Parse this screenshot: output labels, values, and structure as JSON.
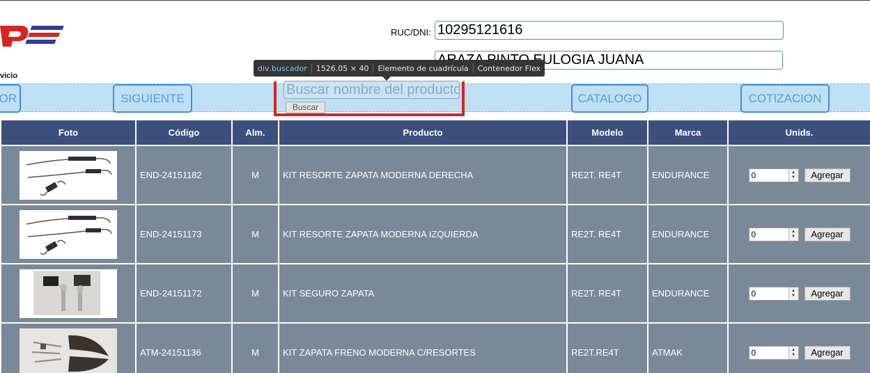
{
  "header": {
    "logo_text": "vicio",
    "ruc_label": "RUC/DNI:",
    "ruc_value": "10295121616",
    "name_value": "ARAZA PINTO EULOGIA JUANA"
  },
  "nav": {
    "prev_label": "OR",
    "next_label": "SIGUIENTE",
    "catalog_label": "CATALOGO",
    "quote_label": "COTIZACION"
  },
  "search": {
    "placeholder": "Buscar nombre del producto",
    "button_label": "Buscar"
  },
  "tooltip": {
    "tag": "div",
    "class": ".buscador",
    "size": "1526.05 × 40",
    "grid": "Elemento de cuadrícula",
    "flex": "Contenedor Flex"
  },
  "table": {
    "headers": [
      "Foto",
      "Código",
      "Alm.",
      "Producto",
      "Modelo",
      "Marca",
      "Unids."
    ],
    "rows": [
      {
        "code": "END-24151182",
        "alm": "M",
        "product": "KIT RESORTE ZAPATA MODERNA DERECHA",
        "model": "RE2T. RE4T",
        "brand": "ENDURANCE",
        "qty": "0",
        "add": "Agregar",
        "photo": "springs"
      },
      {
        "code": "END-24151173",
        "alm": "M",
        "product": "KIT RESORTE ZAPATA MODERNA IZQUIERDA",
        "model": "RE2T. RE4T",
        "brand": "ENDURANCE",
        "qty": "0",
        "add": "Agregar",
        "photo": "springs"
      },
      {
        "code": "END-24151172",
        "alm": "M",
        "product": "KIT SEGURO ZAPATA",
        "model": "RE2T. RE4T",
        "brand": "ENDURANCE",
        "qty": "0",
        "add": "Agregar",
        "photo": "pins"
      },
      {
        "code": "ATM-24151136",
        "alm": "M",
        "product": "KIT ZAPATA FRENO MODERNA C/RESORTES",
        "model": "RE2T.RE4T",
        "brand": "ATMAK",
        "qty": "0",
        "add": "Agregar",
        "photo": "shoes"
      }
    ]
  },
  "colors": {
    "nav_bg": "#bfe0f5",
    "header_bg": "#3d4f7c",
    "row_bg": "#7b8898",
    "accent": "#3d8ee0",
    "highlight": "#d9241f"
  }
}
